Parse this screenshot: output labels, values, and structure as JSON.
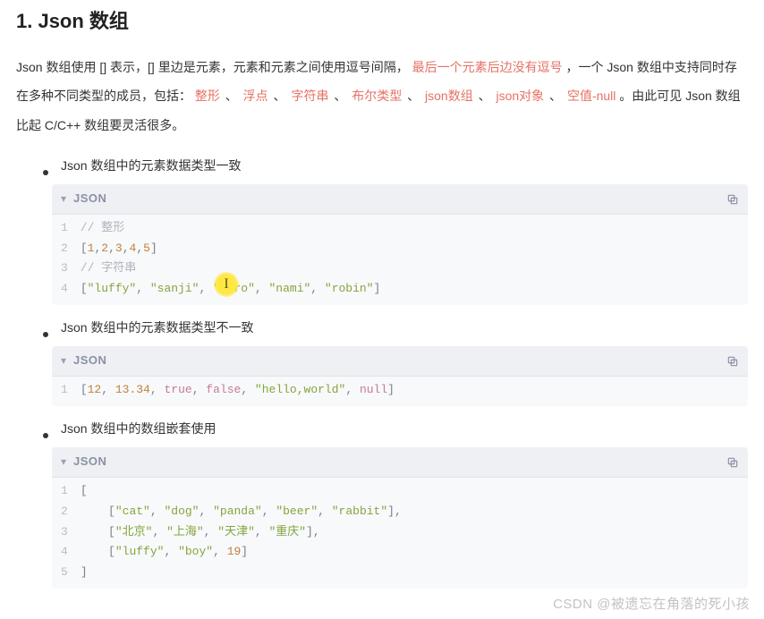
{
  "heading": "1. Json 数组",
  "intro": {
    "t1": "Json 数组使用 [] 表示，[] 里边是元素，元素和元素之间使用逗号间隔，",
    "hl_last": "最后一个元素后边没有逗号",
    "t2": "，一个 Json 数组中支持同时存在多种不同类型的成员，包括：",
    "types": [
      "整形",
      "浮点",
      "字符串",
      "布尔类型",
      "json数组",
      "json对象",
      "空值-null"
    ],
    "t3": "。由此可见 Json 数组比起 C/C++ 数组要灵活很多。"
  },
  "sections": [
    {
      "title": "Json 数组中的元素数据类型一致"
    },
    {
      "title": "Json 数组中的元素数据类型不一致"
    },
    {
      "title": "Json 数组中的数组嵌套使用"
    }
  ],
  "code_lang": "JSON",
  "code1": {
    "c1": "// 整形",
    "l2": {
      "a": "[",
      "n": [
        "1",
        "2",
        "3",
        "4",
        "5"
      ],
      "z": "]"
    },
    "c3": "// 字符串",
    "l4": {
      "a": "[",
      "s": [
        "\"luffy\"",
        "\"sanji\"",
        "\"zoro\"",
        "\"nami\"",
        "\"robin\""
      ],
      "z": "]"
    }
  },
  "code2": {
    "l1": {
      "open": "[",
      "items": [
        {
          "type": "num",
          "v": "12"
        },
        {
          "type": "num",
          "v": "13.34"
        },
        {
          "type": "kw",
          "v": "true"
        },
        {
          "type": "kw",
          "v": "false"
        },
        {
          "type": "str",
          "v": "\"hello,world\""
        },
        {
          "type": "null",
          "v": "null"
        }
      ],
      "close": "]"
    }
  },
  "code3": {
    "l1": "[",
    "l2": {
      "indent": "    ",
      "open": "[",
      "s": [
        "\"cat\"",
        "\"dog\"",
        "\"panda\"",
        "\"beer\"",
        "\"rabbit\""
      ],
      "close": "],"
    },
    "l3": {
      "indent": "    ",
      "open": "[",
      "s": [
        "\"北京\"",
        "\"上海\"",
        "\"天津\"",
        "\"重庆\""
      ],
      "close": "],"
    },
    "l4": {
      "indent": "    ",
      "open": "[",
      "mix": [
        {
          "t": "str",
          "v": "\"luffy\""
        },
        {
          "t": "str",
          "v": "\"boy\""
        },
        {
          "t": "num",
          "v": "19"
        }
      ],
      "close": "]"
    },
    "l5": "]"
  },
  "watermark": "CSDN @被遗忘在角落的死小孩",
  "sep": " 、 ",
  "comma": ", "
}
